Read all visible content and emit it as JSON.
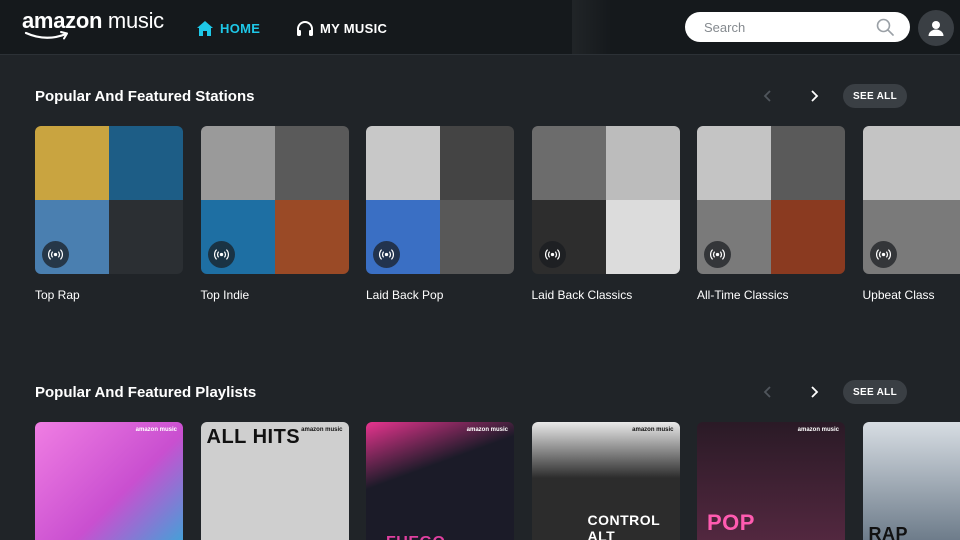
{
  "header": {
    "logo_word": "amazon",
    "logo_sub": "music",
    "nav_home": "HOME",
    "nav_my_music": "MY MUSIC",
    "search_placeholder": "Search",
    "accent_color": "#1ec8e8"
  },
  "stations": {
    "title": "Popular And Featured Stations",
    "see_all": "SEE ALL",
    "items": [
      {
        "label": "Top Rap",
        "colors": [
          "#c9a440",
          "#1d5d86",
          "#4a7fb0",
          "#2b2f33"
        ]
      },
      {
        "label": "Top Indie",
        "colors": [
          "#9a9a9a",
          "#5a5a5a",
          "#1e6fa3",
          "#9a4a26"
        ]
      },
      {
        "label": "Laid Back Pop",
        "colors": [
          "#c8c8c8",
          "#444444",
          "#3a6fc4",
          "#585858"
        ]
      },
      {
        "label": "Laid Back Classics",
        "colors": [
          "#6c6c6c",
          "#bcbcbc",
          "#2d2d2d",
          "#dcdcdc"
        ]
      },
      {
        "label": "All-Time Classics",
        "colors": [
          "#c4c4c4",
          "#5a5a5a",
          "#7a7a7a",
          "#8a3a20"
        ]
      },
      {
        "label": "Upbeat Class",
        "colors": [
          "#c4c4c4",
          "#c4c4c4",
          "#7a7a7a",
          "#7a7a7a"
        ]
      }
    ]
  },
  "playlists": {
    "title": "Popular And Featured Playlists",
    "see_all": "SEE ALL",
    "items": [
      {
        "brand": "amazon music",
        "text": "",
        "bg": "#e26bd6"
      },
      {
        "brand": "amazon music",
        "text": "ALL HITS",
        "bg": "#cfcfcf"
      },
      {
        "brand": "amazon music",
        "text": "FUEGO",
        "bg": "#1b1b28"
      },
      {
        "brand": "amazon music",
        "text": "CONTROL ALT",
        "bg": "#e9e9e9"
      },
      {
        "brand": "amazon music",
        "text": "POP CULTURE",
        "bg": "#2a1a26"
      },
      {
        "brand": "",
        "text": "RAP",
        "bg": "#c8d0d8"
      }
    ]
  }
}
